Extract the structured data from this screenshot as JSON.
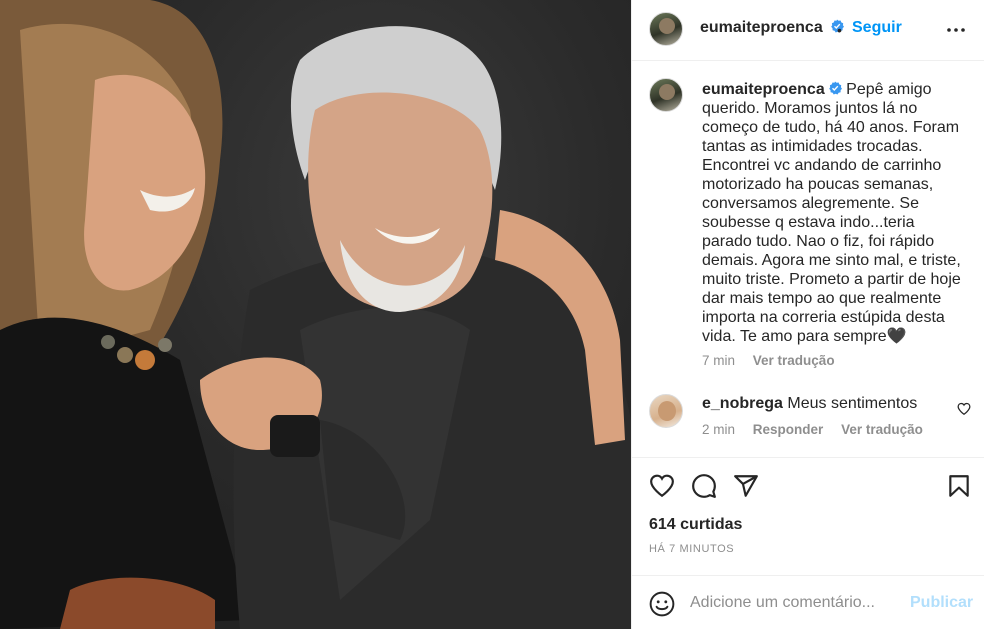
{
  "post": {
    "owner": {
      "username": "eumaiteproenca",
      "verified": true,
      "avatar_icon": "profile-avatar"
    },
    "follow_label": "Seguir",
    "separator": "•",
    "caption": "Pepê amigo querido. Moramos juntos lá no começo de tudo, há 40 anos. Foram tantas as intimidades trocadas. Encontrei vc andando de carrinho motorizado ha poucas semanas, conversamos alegremente. Se soubesse q estava indo...teria parado tudo. Nao o fiz, foi rápido demais. Agora me sinto mal, e triste, muito triste. Prometo a partir de hoje dar mais tempo ao que realmente importa na correria estúpida desta vida. Te amo para sempre🖤",
    "caption_time": "7 min",
    "caption_translate": "Ver tradução",
    "likes": "614 curtidas",
    "posted_ago": "HÁ 7 MINUTOS"
  },
  "comments": [
    {
      "username": "e_nobrega",
      "text": "Meus sentimentos",
      "time": "2 min",
      "reply_label": "Responder",
      "translate_label": "Ver tradução"
    }
  ],
  "composer": {
    "placeholder": "Adicione um comentário...",
    "publish_label": "Publicar"
  },
  "icons": [
    "heart-icon",
    "comment-icon",
    "share-icon",
    "bookmark-icon",
    "emoji-icon",
    "more-options-icon",
    "verified-badge-icon"
  ],
  "colors": {
    "accent": "#0095f6",
    "publish_disabled": "#b2dffc",
    "verified": "#3897f0",
    "muted": "#8e8e8e",
    "border": "#efefef"
  }
}
